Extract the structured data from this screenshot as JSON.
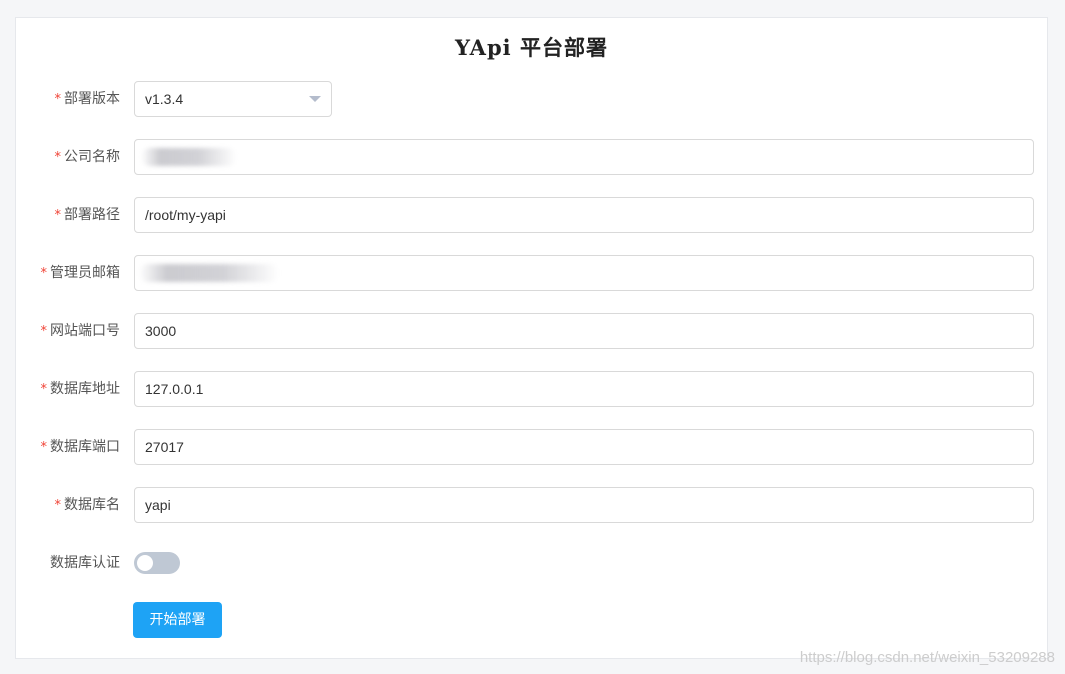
{
  "title": "YApi 平台部署",
  "form": {
    "version": {
      "label": "部署版本",
      "value": "v1.3.4",
      "required": "*"
    },
    "company": {
      "label": "公司名称",
      "value": "",
      "required": "*"
    },
    "path": {
      "label": "部署路径",
      "value": "/root/my-yapi",
      "required": "*"
    },
    "admin_email": {
      "label": "管理员邮箱",
      "value": "",
      "required": "*"
    },
    "site_port": {
      "label": "网站端口号",
      "value": "3000",
      "required": "*"
    },
    "db_host": {
      "label": "数据库地址",
      "value": "127.0.0.1",
      "required": "*"
    },
    "db_port": {
      "label": "数据库端口",
      "value": "27017",
      "required": "*"
    },
    "db_name": {
      "label": "数据库名",
      "value": "yapi",
      "required": "*"
    },
    "db_auth": {
      "label": "数据库认证",
      "enabled": false
    }
  },
  "submit_label": "开始部署",
  "watermark": "https://blog.csdn.net/weixin_53209288",
  "colors": {
    "accent": "#1ea3f5",
    "required": "#f04134",
    "toggle_off": "#bfc8d4"
  },
  "icons": {
    "select_caret": "chevron-down-icon"
  }
}
